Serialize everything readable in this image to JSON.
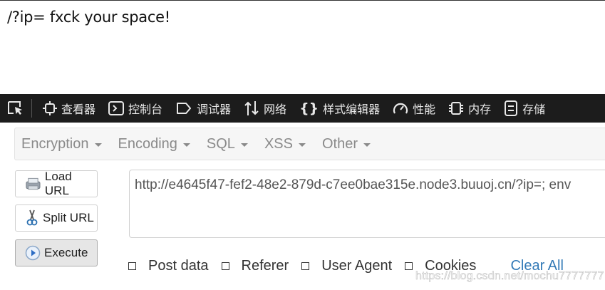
{
  "page": {
    "text": "/?ip= fxck your space!"
  },
  "devtools": {
    "tabs": [
      {
        "label": "查看器",
        "icon": "inspector-icon"
      },
      {
        "label": "控制台",
        "icon": "console-icon"
      },
      {
        "label": "调试器",
        "icon": "debugger-icon"
      },
      {
        "label": "网络",
        "icon": "network-icon"
      },
      {
        "label": "样式编辑器",
        "icon": "style-editor-icon"
      },
      {
        "label": "性能",
        "icon": "performance-icon"
      },
      {
        "label": "内存",
        "icon": "memory-icon"
      },
      {
        "label": "存储",
        "icon": "storage-icon"
      }
    ]
  },
  "hackbar": {
    "menu": [
      "Encryption",
      "Encoding",
      "SQL",
      "XSS",
      "Other"
    ],
    "buttons": {
      "load": "Load URL",
      "split": "Split URL",
      "execute": "Execute"
    },
    "url": "http://e4645f47-fef2-48e2-879d-c7ee0bae315e.node3.buuoj.cn/?ip=; env",
    "options": [
      "Post data",
      "Referer",
      "User Agent",
      "Cookies"
    ],
    "clear_all": "Clear All"
  },
  "watermark": "https://blog.csdn.net/mochu7777777"
}
